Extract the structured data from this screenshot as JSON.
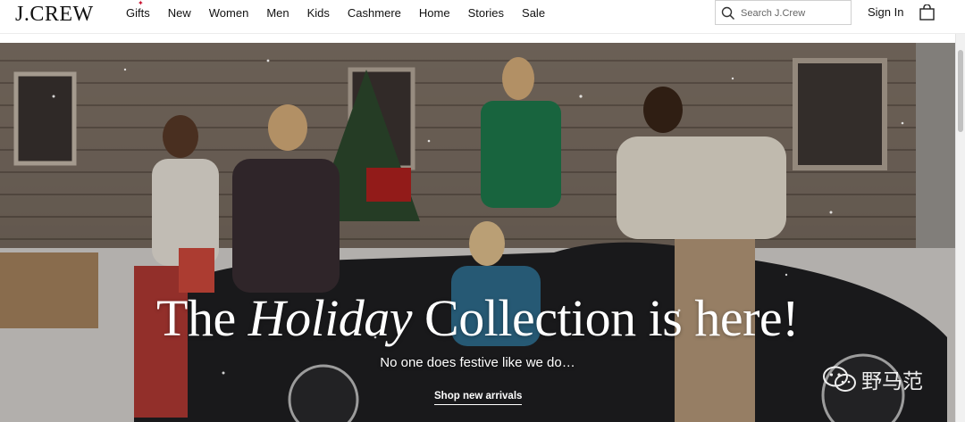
{
  "brand": {
    "logo_text": "J.CREW"
  },
  "nav": {
    "items": [
      {
        "label": "Gifts",
        "marker": "✦"
      },
      {
        "label": "New"
      },
      {
        "label": "Women"
      },
      {
        "label": "Men"
      },
      {
        "label": "Kids"
      },
      {
        "label": "Cashmere"
      },
      {
        "label": "Home"
      },
      {
        "label": "Stories"
      },
      {
        "label": "Sale"
      }
    ]
  },
  "search": {
    "placeholder": "Search J.Crew",
    "icon": "search-icon"
  },
  "account": {
    "signin_label": "Sign In",
    "bag_icon": "shopping-bag-icon"
  },
  "hero": {
    "title_part1": "The ",
    "title_em": "Holiday",
    "title_part2": " Collection is here!",
    "subtitle": "No one does festive like we do…",
    "cta_label": "Shop new arrivals"
  },
  "watermark": {
    "text": "野马范",
    "icon": "wechat-icon"
  },
  "colors": {
    "accent_red": "#c8102e",
    "header_bg": "#ffffff",
    "text": "#111111"
  }
}
